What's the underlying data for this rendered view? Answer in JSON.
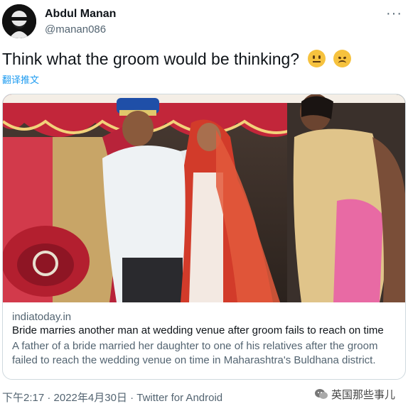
{
  "user": {
    "display_name": "Abdul Manan",
    "handle": "@manan086",
    "avatar_icon": "avatar-image"
  },
  "tweet": {
    "text": "Think what the groom would be thinking?",
    "emojis": [
      "neutral-face-emoji",
      "disappointed-face-emoji"
    ],
    "translate_label": "翻译推文"
  },
  "card": {
    "domain": "indiatoday.in",
    "title": "Bride marries another man at wedding venue after groom fails to reach on time",
    "description": "A father of a bride married her daughter to one of his relatives after the groom failed to reach the wedding venue on time in Maharashtra's Buldhana district."
  },
  "meta": {
    "timestamp": "下午2:17 · 2022年4月30日 · Twitter for Android"
  },
  "watermark": {
    "text": "英国那些事儿"
  },
  "colors": {
    "link": "#1d9bf0",
    "secondary_text": "#536471",
    "primary_text": "#0f1419",
    "border": "#cfd9de"
  }
}
